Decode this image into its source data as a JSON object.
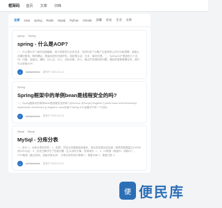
{
  "header": {
    "logo": "框架码",
    "nav": [
      "首页",
      "文章",
      "归档"
    ]
  },
  "tabs": [
    "全部",
    "Java",
    "spring",
    "Redis",
    "Mysql",
    "Python",
    "GitHub",
    "部署",
    "优化",
    "生活",
    "文章"
  ],
  "posts": [
    {
      "tags": [
        "spring",
        "Spring"
      ],
      "title": "spring - 什么是AOP?",
      "summary": "一、什么是AOP? 面向切面编程，用于将那些与业务无关，但却对多个对象产生影响的公共行为和逻辑，抽取公共模块复用，降低耦合，提高系统的可维护性。如权限认证、日志、事务处理。二、Spring AOP里面的几个名词：切面、连接点、通知、切入点、引入、目标对象、织入。最近开发遇到的问题，看起来很像是耦合的，我们可以使用AOP，",
      "author": "tuohameeniu",
      "time": "发布于 2023-10-14"
    },
    {
      "tags": [
        "Spring"
      ],
      "title": "Spring框架中的单例bean是线程安全的吗?",
      "summary": "一、Spring框架中的单例bean是线程安全的吗? @Service @Scope(\"singleton\") public class UserServiceImpl implements UserService {} singleton: bean在每个Spring IOC容器中只有一个实例。",
      "author": "tuohameeniu",
      "time": "发布于 2023-10-13"
    },
    {
      "tags": [
        "Mysql",
        "Mysql"
      ],
      "title": "MySql - 分库分表",
      "summary": "一、拆分 1、分库分表的时机：1、前提，项目业务数据逐渐增多，或业务发展比较迅速（单表的数据量达1000W或20G以后） 2、优化已解决不了性能问题（主从读写分离、查询索引…） 3、IO瓶颈（磁盘IO、网络IO）、CPU瓶颈（聚合查询、连接次数太多） 分表分库的拆分策略 1、垂直分库 2、垂直分表 3、",
      "author": "tuohameeniu",
      "time": "发布于 2023-10-12"
    }
  ],
  "watermark": {
    "icon": "便",
    "text": "便民库"
  }
}
